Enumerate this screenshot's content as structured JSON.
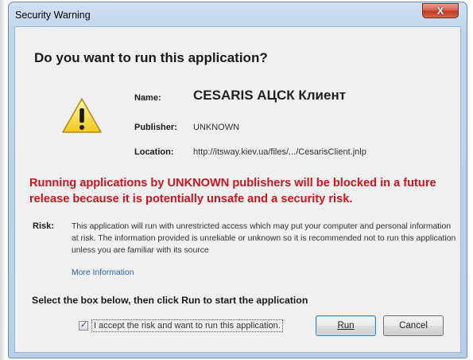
{
  "window": {
    "title": "Security Warning",
    "close_label": "X"
  },
  "dialog": {
    "question": "Do you want to run this application?",
    "icon": "warning-triangle-icon",
    "fields": {
      "name_label": "Name:",
      "name_value": "CESARIS АЦСК Клиент",
      "publisher_label": "Publisher:",
      "publisher_value": "UNKNOWN",
      "location_label": "Location:",
      "location_value": "http://itsway.kiev.ua/files/.../CesarisClient.jnlp"
    },
    "warning_text": "Running applications by UNKNOWN publishers will be blocked in a future release because it is potentially unsafe and a security risk.",
    "risk_label": "Risk:",
    "risk_text": "This application will run with unrestricted access which may put your computer and personal information at risk. The information provided is unreliable or unknown so it is recommended not to run this application unless you are familiar with its source",
    "more_info": "More Information",
    "instruction": "Select the box below, then click Run to start the application",
    "checkbox_checked": true,
    "checkbox_label": "I accept the risk and want to run this application.",
    "run_label": "Run",
    "cancel_label": "Cancel"
  },
  "colors": {
    "warning_red": "#d0131c",
    "link_blue": "#2f5fa8",
    "close_red": "#c23b22",
    "frame_blue": "#bfd5ec"
  }
}
